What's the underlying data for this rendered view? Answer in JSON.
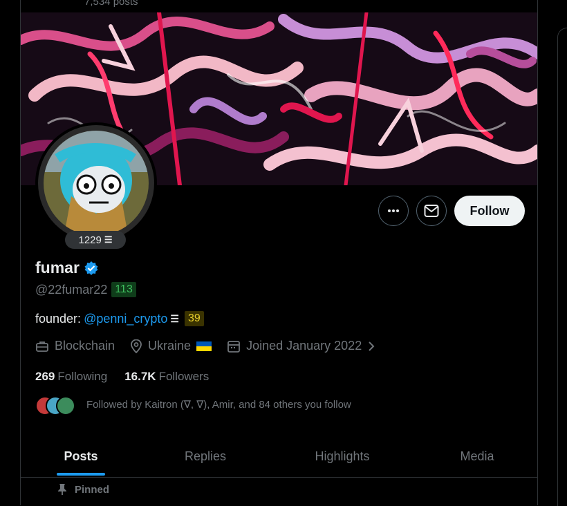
{
  "header": {
    "post_count": "7,534 posts"
  },
  "profile": {
    "rank_value": "1229",
    "rank_glyph": "☰",
    "name": "fumar",
    "verified": true,
    "handle": "@22fumar22",
    "handle_badge": "113",
    "bio_prefix": "founder:",
    "bio_mention": "@penni_crypto",
    "bio_glyph": "☰",
    "bio_badge": "39",
    "category": "Blockchain",
    "location": "Ukraine",
    "joined": "Joined January 2022",
    "following_count": "269",
    "following_label": "Following",
    "followers_count": "16.7K",
    "followers_label": "Followers",
    "followed_by": "Followed by Kaitron (∇, ∇), Amir, and 84 others you follow"
  },
  "actions": {
    "follow_label": "Follow"
  },
  "tabs": [
    {
      "label": "Posts",
      "active": true
    },
    {
      "label": "Replies",
      "active": false
    },
    {
      "label": "Highlights",
      "active": false
    },
    {
      "label": "Media",
      "active": false
    }
  ],
  "pinned_label": "Pinned",
  "colors": {
    "accent": "#1d9bf0",
    "verified": "#1d9bf0",
    "green_badge": "#3fbf5f",
    "yellow_badge": "#e8cf2b"
  }
}
